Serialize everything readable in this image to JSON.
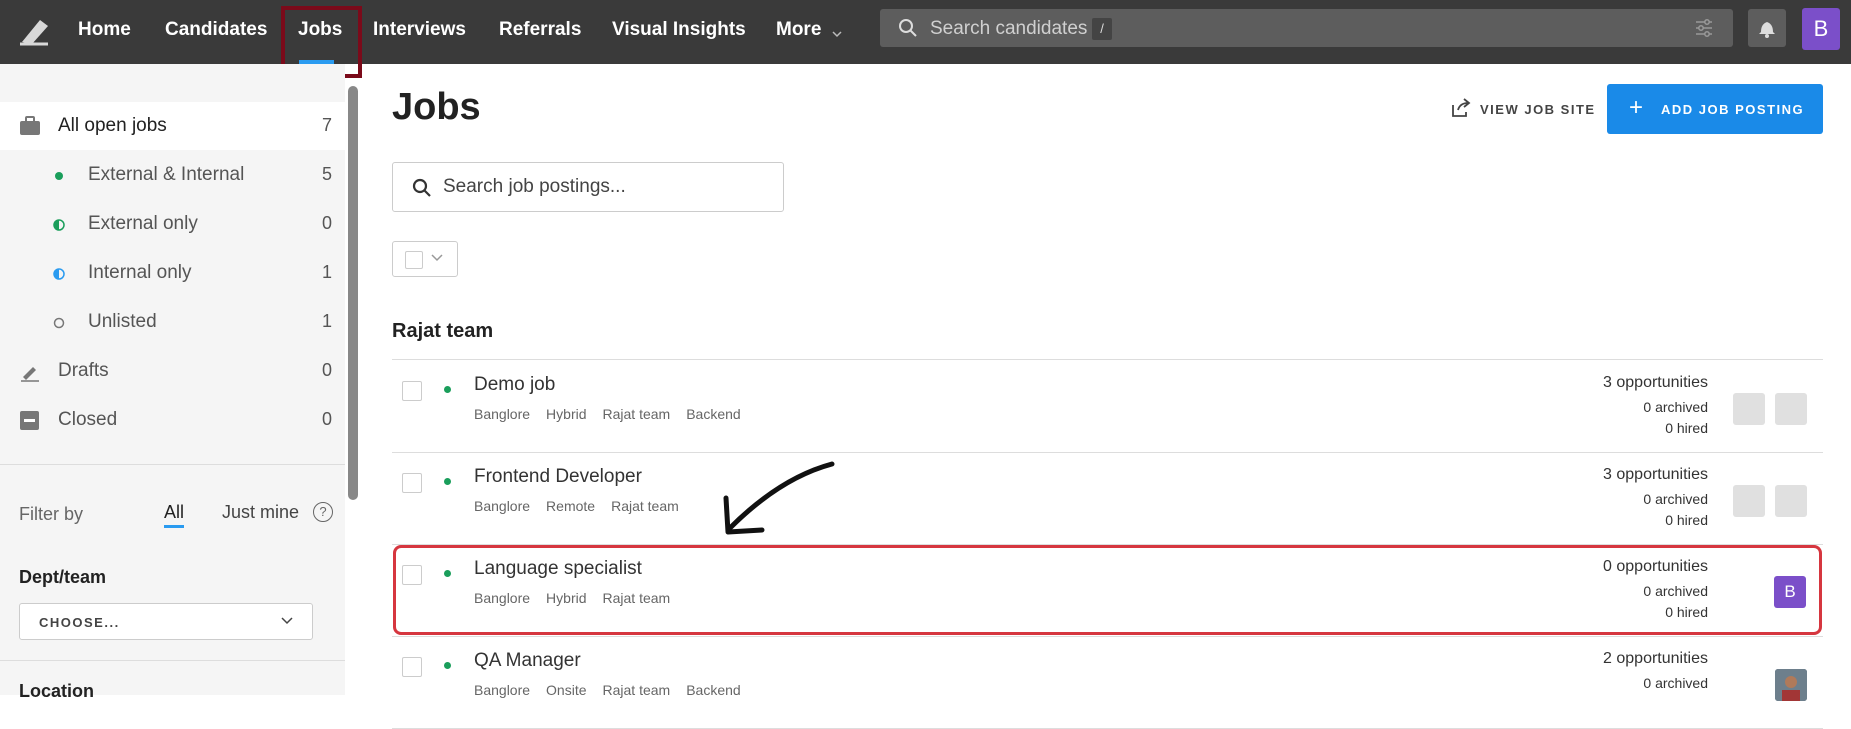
{
  "nav": {
    "items": [
      "Home",
      "Candidates",
      "Jobs",
      "Interviews",
      "Referrals",
      "Visual Insights",
      "More"
    ],
    "search_placeholder": "Search candidates",
    "search_shortcut": "/",
    "user_initial": "B"
  },
  "sidebar": {
    "items": [
      {
        "label": "All open jobs",
        "count": "7"
      },
      {
        "label": "External & Internal",
        "count": "5"
      },
      {
        "label": "External only",
        "count": "0"
      },
      {
        "label": "Internal only",
        "count": "1"
      },
      {
        "label": "Unlisted",
        "count": "1"
      },
      {
        "label": "Drafts",
        "count": "0"
      },
      {
        "label": "Closed",
        "count": "0"
      }
    ],
    "filter_by": "Filter by",
    "filter_all": "All",
    "filter_mine": "Just mine",
    "dept_label": "Dept/team",
    "dept_select": "CHOOSE...",
    "location_label": "Location"
  },
  "main": {
    "title": "Jobs",
    "view_job_site": "VIEW JOB SITE",
    "add_job_posting": "ADD JOB POSTING",
    "search_placeholder": "Search job postings...",
    "team": "Rajat team",
    "jobs": [
      {
        "title": "Demo job",
        "tags": [
          "Banglore",
          "Hybrid",
          "Rajat team",
          "Backend"
        ],
        "opportunities": "3 opportunities",
        "archived": "0 archived",
        "hired": "0 hired"
      },
      {
        "title": "Frontend Developer",
        "tags": [
          "Banglore",
          "Remote",
          "Rajat team"
        ],
        "opportunities": "3 opportunities",
        "archived": "0 archived",
        "hired": "0 hired"
      },
      {
        "title": "Language specialist",
        "tags": [
          "Banglore",
          "Hybrid",
          "Rajat team"
        ],
        "opportunities": "0 opportunities",
        "archived": "0 archived",
        "hired": "0 hired",
        "owner_initial": "B"
      },
      {
        "title": "QA Manager",
        "tags": [
          "Banglore",
          "Onsite",
          "Rajat team",
          "Backend"
        ],
        "opportunities": "2 opportunities",
        "archived": "0 archived",
        "hired": ""
      }
    ]
  },
  "colors": {
    "accent": "#1a8ae8",
    "topbar": "#3a3a3a",
    "highlight": "#d6363f",
    "avatar": "#7b4fc9"
  }
}
